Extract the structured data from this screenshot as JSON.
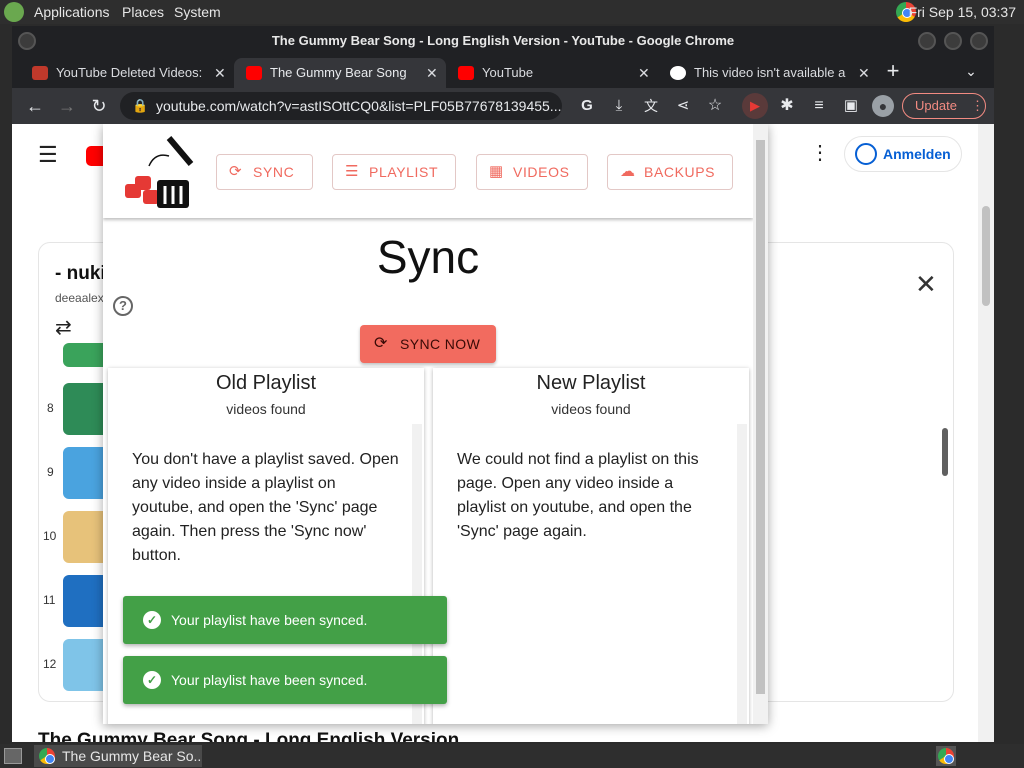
{
  "desktop": {
    "menus": [
      "Applications",
      "Places",
      "System"
    ],
    "clock": "Fri Sep 15, 03:37"
  },
  "window": {
    "title": "The Gummy Bear Song - Long English Version - YouTube - Google Chrome"
  },
  "tabs": [
    {
      "label": "YouTube Deleted Videos:"
    },
    {
      "label": "The Gummy Bear Song"
    },
    {
      "label": "YouTube"
    },
    {
      "label": "This video isn't available a"
    }
  ],
  "toolbar": {
    "url": "youtube.com/watch?v=astISOttCQ0&list=PLF05B77678139455...",
    "update_label": "Update"
  },
  "youtube": {
    "signin_label": "Anmelden",
    "playlist_title": "- nuki",
    "playlist_owner": "deeaalex",
    "item_numbers": [
      "8",
      "9",
      "10",
      "11",
      "12"
    ],
    "video_title": "The Gummy Bear Song - Long English Version"
  },
  "extension": {
    "nav": [
      "SYNC",
      "PLAYLIST",
      "VIDEOS",
      "BACKUPS"
    ],
    "heading": "Sync",
    "help_glyph": "?",
    "sync_now_label": "SYNC NOW",
    "old_panel": {
      "title": "Old Playlist",
      "subtitle": "videos found",
      "body": "You don't have a playlist saved. Open any video inside a playlist on youtube, and open the 'Sync' page again. Then press the 'Sync now' button."
    },
    "new_panel": {
      "title": "New Playlist",
      "subtitle": "videos found",
      "body": "We could not find a playlist on this page. Open any video inside a playlist on youtube, and open the 'Sync' page again."
    },
    "toasts": [
      "Your playlist have been synced.",
      "Your playlist have been synced."
    ]
  },
  "taskbar": {
    "task_label": "The Gummy Bear So..."
  },
  "colors": {
    "accent": "#f26b5f",
    "toast_green": "#43a047",
    "update_red": "#f28b82"
  }
}
